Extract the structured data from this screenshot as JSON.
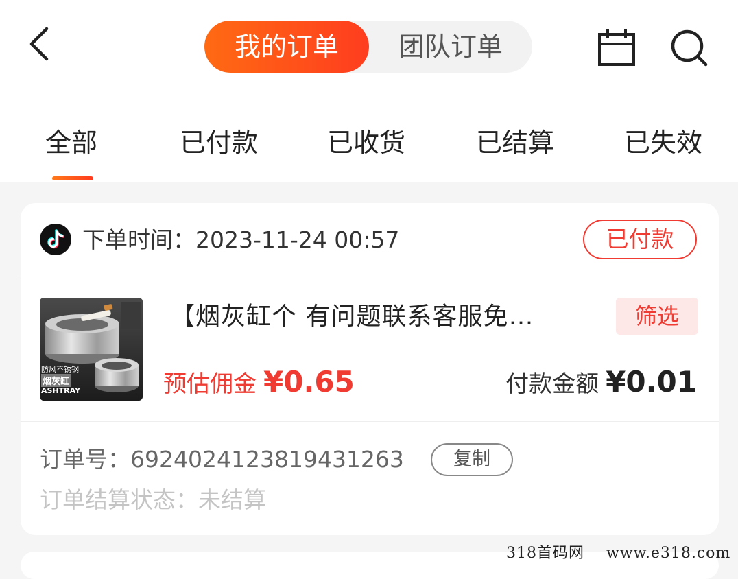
{
  "header": {
    "segment_active": "我的订单",
    "segment_inactive": "团队订单",
    "icons": {
      "back": "back-arrow-icon",
      "calendar": "calendar-icon",
      "search": "search-icon"
    },
    "colors": {
      "accent_gradient_start": "#ff6a13",
      "accent_gradient_end": "#ff3d1f",
      "status_red": "#ef3b32"
    }
  },
  "tabs": [
    {
      "label": "全部",
      "active": true
    },
    {
      "label": "已付款",
      "active": false
    },
    {
      "label": "已收货",
      "active": false
    },
    {
      "label": "已结算",
      "active": false
    },
    {
      "label": "已失效",
      "active": false
    }
  ],
  "order": {
    "platform_icon": "tiktok-icon",
    "order_time_label": "下单时间：",
    "order_time": "2023-11-24 00:57",
    "status": "已付款",
    "product": {
      "image_texts": {
        "line1": "防风不锈钢",
        "line2": "烟灰缸",
        "line3": "ASHTRAY"
      },
      "title": "【烟灰缸个  有问题联系客服免…",
      "tag": "筛选"
    },
    "commission_label": "预估佣金",
    "commission_value": "¥0.65",
    "payment_label": "付款金额",
    "payment_value": "¥0.01",
    "order_no_label": "订单号：",
    "order_no": "6924024123819431263",
    "copy_label": "复制",
    "settle_label": "订单结算状态：",
    "settle_status": "未结算"
  },
  "watermark": "318首码网    www.e318.com"
}
